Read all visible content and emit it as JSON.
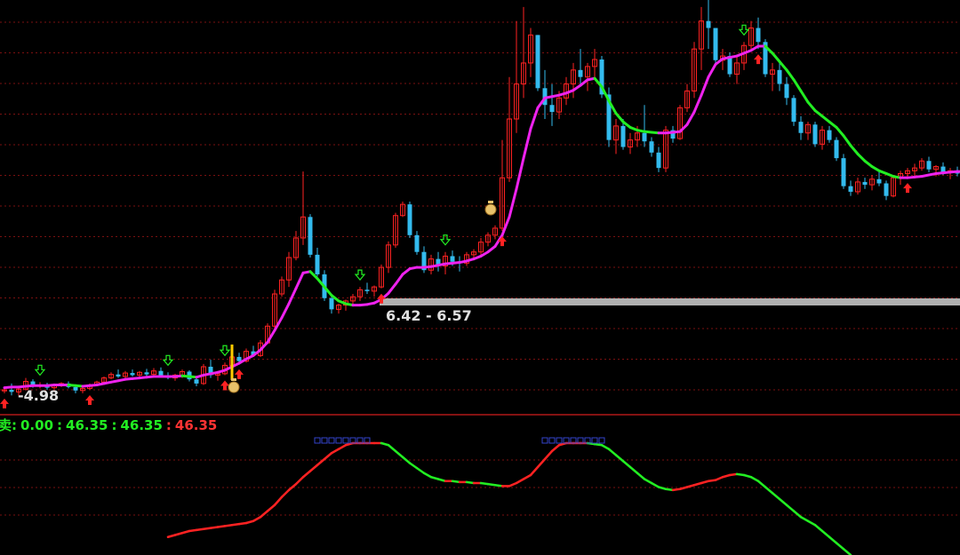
{
  "colors": {
    "background": "#000000",
    "grid": "#7a1010",
    "separator": "#b01818",
    "candle_up": "#ff2222",
    "candle_down": "#33bbee",
    "ma_rising": "#ee22ee",
    "ma_falling": "#22ee22",
    "osc_rising": "#ff2222",
    "osc_falling": "#22ee22",
    "zone_band": "#b0b0b0",
    "zone_text": "#e0e0e0",
    "buy_arrow": "#ff2222",
    "sell_arrow": "#22ee22",
    "signal_bar": "#ffcc00",
    "label_green": "#22ee22",
    "label_red": "#ff3333",
    "top_marker": "#3344cc"
  },
  "price_panel": {
    "zone_label": "6.42 - 6.57",
    "low_label": "4.98",
    "money_bag_icon": "money-bag-icon"
  },
  "indicator_panel": {
    "title_prefix": "卖:",
    "value_1": "0.00",
    "sep_1": ":",
    "value_2": "46.35",
    "sep_2": ":",
    "value_3": "46.35",
    "sep_3": ":",
    "value_4": "46.35"
  },
  "chart_data": [
    {
      "type": "candlestick",
      "candles": [
        [
          4.92,
          4.95,
          4.88,
          4.93
        ],
        [
          4.93,
          5.02,
          4.85,
          4.9
        ],
        [
          4.9,
          4.96,
          4.85,
          4.94
        ],
        [
          4.94,
          5.1,
          4.92,
          5.05
        ],
        [
          5.05,
          5.08,
          4.96,
          4.98
        ],
        [
          4.98,
          5.04,
          4.95,
          5.0
        ],
        [
          5.0,
          5.03,
          4.93,
          4.96
        ],
        [
          4.96,
          5.02,
          4.94,
          5.0
        ],
        [
          5.0,
          5.04,
          4.97,
          5.02
        ],
        [
          5.02,
          5.05,
          4.95,
          4.97
        ],
        [
          4.97,
          5.0,
          4.88,
          4.92
        ],
        [
          4.92,
          4.97,
          4.88,
          4.95
        ],
        [
          4.95,
          5.02,
          4.93,
          5.0
        ],
        [
          5.0,
          5.06,
          4.98,
          5.04
        ],
        [
          5.04,
          5.12,
          5.02,
          5.1
        ],
        [
          5.1,
          5.18,
          5.08,
          5.15
        ],
        [
          5.15,
          5.22,
          5.1,
          5.12
        ],
        [
          5.12,
          5.2,
          5.09,
          5.17
        ],
        [
          5.17,
          5.22,
          5.12,
          5.14
        ],
        [
          5.14,
          5.2,
          5.1,
          5.18
        ],
        [
          5.18,
          5.23,
          5.12,
          5.15
        ],
        [
          5.15,
          5.24,
          5.11,
          5.2
        ],
        [
          5.2,
          5.25,
          5.12,
          5.13
        ],
        [
          5.13,
          5.18,
          5.08,
          5.1
        ],
        [
          5.1,
          5.16,
          5.06,
          5.14
        ],
        [
          5.14,
          5.22,
          5.1,
          5.19
        ],
        [
          5.19,
          5.21,
          5.05,
          5.08
        ],
        [
          5.08,
          5.1,
          4.98,
          5.02
        ],
        [
          5.02,
          5.3,
          5.0,
          5.26
        ],
        [
          5.26,
          5.36,
          5.1,
          5.14
        ],
        [
          5.14,
          5.2,
          5.06,
          5.16
        ],
        [
          5.16,
          5.32,
          5.14,
          5.28
        ],
        [
          5.28,
          5.45,
          5.25,
          5.4
        ],
        [
          5.4,
          5.46,
          5.3,
          5.34
        ],
        [
          5.34,
          5.52,
          5.32,
          5.48
        ],
        [
          5.48,
          5.56,
          5.4,
          5.42
        ],
        [
          5.42,
          5.64,
          5.4,
          5.6
        ],
        [
          5.6,
          5.88,
          5.58,
          5.84
        ],
        [
          5.84,
          6.36,
          5.8,
          6.3
        ],
        [
          6.3,
          6.55,
          6.26,
          6.5
        ],
        [
          6.5,
          6.9,
          6.4,
          6.82
        ],
        [
          6.82,
          7.2,
          6.78,
          7.1
        ],
        [
          7.1,
          8.05,
          7.0,
          7.4
        ],
        [
          7.4,
          7.44,
          6.82,
          6.86
        ],
        [
          6.86,
          6.96,
          6.55,
          6.58
        ],
        [
          6.58,
          6.64,
          6.2,
          6.24
        ],
        [
          6.24,
          6.3,
          6.02,
          6.08
        ],
        [
          6.08,
          6.16,
          6.02,
          6.14
        ],
        [
          6.14,
          6.22,
          6.06,
          6.2
        ],
        [
          6.2,
          6.3,
          6.12,
          6.26
        ],
        [
          6.26,
          6.4,
          6.2,
          6.36
        ],
        [
          6.36,
          6.46,
          6.3,
          6.34
        ],
        [
          6.34,
          6.42,
          6.26,
          6.4
        ],
        [
          6.4,
          6.72,
          6.38,
          6.68
        ],
        [
          6.68,
          7.05,
          6.6,
          7.0
        ],
        [
          7.0,
          7.46,
          6.96,
          7.42
        ],
        [
          7.42,
          7.62,
          7.4,
          7.58
        ],
        [
          7.58,
          7.62,
          7.1,
          7.14
        ],
        [
          7.14,
          7.2,
          6.86,
          6.9
        ],
        [
          6.9,
          6.98,
          6.6,
          6.64
        ],
        [
          6.64,
          6.86,
          6.58,
          6.8
        ],
        [
          6.8,
          6.9,
          6.62,
          6.7
        ],
        [
          6.7,
          6.9,
          6.58,
          6.84
        ],
        [
          6.84,
          6.92,
          6.7,
          6.76
        ],
        [
          6.76,
          6.84,
          6.62,
          6.74
        ],
        [
          6.74,
          6.9,
          6.7,
          6.86
        ],
        [
          6.86,
          6.94,
          6.78,
          6.9
        ],
        [
          6.9,
          7.1,
          6.85,
          7.04
        ],
        [
          7.04,
          7.18,
          6.98,
          7.14
        ],
        [
          7.14,
          7.28,
          7.08,
          7.24
        ],
        [
          7.24,
          8.5,
          7.2,
          7.96
        ],
        [
          7.96,
          9.4,
          7.9,
          8.8
        ],
        [
          8.8,
          10.2,
          8.6,
          9.3
        ],
        [
          9.3,
          10.4,
          9.1,
          9.6
        ],
        [
          9.6,
          10.1,
          9.4,
          10.0
        ],
        [
          10.0,
          10.0,
          9.2,
          9.24
        ],
        [
          9.24,
          9.5,
          8.8,
          9.0
        ],
        [
          9.0,
          9.3,
          8.7,
          8.9
        ],
        [
          8.9,
          9.2,
          8.8,
          9.1
        ],
        [
          9.1,
          9.4,
          9.0,
          9.3
        ],
        [
          9.3,
          9.6,
          9.1,
          9.5
        ],
        [
          9.5,
          9.8,
          9.3,
          9.4
        ],
        [
          9.4,
          9.6,
          9.2,
          9.55
        ],
        [
          9.55,
          9.8,
          9.4,
          9.65
        ],
        [
          9.65,
          9.7,
          9.1,
          9.15
        ],
        [
          9.15,
          9.25,
          8.4,
          8.5
        ],
        [
          8.5,
          8.8,
          8.3,
          8.7
        ],
        [
          8.7,
          8.8,
          8.36,
          8.4
        ],
        [
          8.4,
          8.6,
          8.3,
          8.5
        ],
        [
          8.5,
          8.7,
          8.4,
          8.6
        ],
        [
          8.6,
          9.0,
          8.4,
          8.48
        ],
        [
          8.48,
          8.54,
          8.26,
          8.32
        ],
        [
          8.32,
          8.4,
          8.04,
          8.1
        ],
        [
          8.1,
          8.7,
          8.04,
          8.64
        ],
        [
          8.64,
          8.7,
          8.46,
          8.52
        ],
        [
          8.52,
          9.0,
          8.5,
          8.96
        ],
        [
          8.96,
          9.3,
          8.9,
          9.2
        ],
        [
          9.2,
          9.9,
          9.1,
          9.8
        ],
        [
          9.8,
          10.4,
          9.5,
          10.2
        ],
        [
          10.2,
          10.6,
          9.8,
          10.1
        ],
        [
          10.1,
          10.1,
          9.6,
          9.64
        ],
        [
          9.64,
          9.8,
          9.5,
          9.7
        ],
        [
          9.7,
          9.75,
          9.4,
          9.44
        ],
        [
          9.44,
          9.7,
          9.3,
          9.6
        ],
        [
          9.6,
          9.9,
          9.5,
          9.85
        ],
        [
          9.85,
          10.2,
          9.8,
          10.1
        ],
        [
          10.1,
          10.25,
          9.8,
          9.9
        ],
        [
          9.9,
          9.94,
          9.4,
          9.44
        ],
        [
          9.44,
          9.6,
          9.2,
          9.5
        ],
        [
          9.5,
          9.6,
          9.2,
          9.3
        ],
        [
          9.3,
          9.4,
          9.0,
          9.1
        ],
        [
          9.1,
          9.14,
          8.7,
          8.76
        ],
        [
          8.76,
          8.84,
          8.5,
          8.6
        ],
        [
          8.6,
          8.76,
          8.5,
          8.72
        ],
        [
          8.72,
          8.76,
          8.4,
          8.44
        ],
        [
          8.44,
          8.7,
          8.36,
          8.64
        ],
        [
          8.64,
          8.7,
          8.46,
          8.5
        ],
        [
          8.5,
          8.54,
          8.2,
          8.24
        ],
        [
          8.24,
          8.3,
          7.8,
          7.84
        ],
        [
          7.84,
          7.92,
          7.7,
          7.76
        ],
        [
          7.76,
          7.96,
          7.72,
          7.9
        ],
        [
          7.9,
          7.96,
          7.8,
          7.86
        ],
        [
          7.86,
          8.0,
          7.78,
          7.94
        ],
        [
          7.94,
          8.04,
          7.84,
          7.88
        ],
        [
          7.88,
          7.92,
          7.64,
          7.7
        ],
        [
          7.7,
          8.0,
          7.68,
          7.96
        ],
        [
          7.96,
          8.06,
          7.86,
          8.02
        ],
        [
          8.02,
          8.1,
          7.96,
          8.06
        ],
        [
          8.06,
          8.16,
          7.98,
          8.1
        ],
        [
          8.1,
          8.24,
          8.06,
          8.2
        ],
        [
          8.2,
          8.26,
          8.04,
          8.08
        ],
        [
          8.08,
          8.14,
          7.98,
          8.12
        ],
        [
          8.12,
          8.18,
          8.0,
          8.04
        ],
        [
          8.04,
          8.1,
          7.94,
          8.06
        ],
        [
          8.06,
          8.12,
          7.98,
          8.02
        ],
        [
          8.02,
          8.16,
          7.96,
          8.12
        ],
        [
          8.12,
          8.22,
          8.06,
          8.18
        ],
        [
          8.18,
          8.3,
          8.12,
          8.26
        ]
      ],
      "ma": [
        4.96,
        4.97,
        4.97,
        4.98,
        4.99,
        4.99,
        4.99,
        5.0,
        5.0,
        5.0,
        4.99,
        4.98,
        4.99,
        5.0,
        5.02,
        5.04,
        5.06,
        5.08,
        5.09,
        5.1,
        5.11,
        5.12,
        5.12,
        5.12,
        5.12,
        5.13,
        5.12,
        5.11,
        5.14,
        5.16,
        5.18,
        5.21,
        5.26,
        5.31,
        5.37,
        5.42,
        5.5,
        5.61,
        5.78,
        5.96,
        6.16,
        6.38,
        6.6,
        6.62,
        6.52,
        6.4,
        6.28,
        6.2,
        6.16,
        6.14,
        6.14,
        6.15,
        6.17,
        6.22,
        6.31,
        6.44,
        6.58,
        6.66,
        6.68,
        6.68,
        6.69,
        6.71,
        6.73,
        6.74,
        6.75,
        6.77,
        6.8,
        6.84,
        6.9,
        6.98,
        7.14,
        7.4,
        7.8,
        8.24,
        8.66,
        8.96,
        9.1,
        9.12,
        9.14,
        9.17,
        9.21,
        9.28,
        9.36,
        9.38,
        9.26,
        9.06,
        8.88,
        8.76,
        8.68,
        8.64,
        8.62,
        8.61,
        8.6,
        8.6,
        8.61,
        8.62,
        8.72,
        8.9,
        9.14,
        9.4,
        9.58,
        9.66,
        9.68,
        9.7,
        9.74,
        9.78,
        9.84,
        9.84,
        9.74,
        9.62,
        9.5,
        9.36,
        9.2,
        9.04,
        8.92,
        8.84,
        8.76,
        8.68,
        8.56,
        8.42,
        8.3,
        8.2,
        8.12,
        8.06,
        8.02,
        7.98,
        7.96,
        7.96,
        7.97,
        7.98,
        8.0,
        8.02,
        8.03,
        8.04,
        8.05,
        8.05,
        8.05,
        8.06,
        8.08,
        8.1
      ],
      "buy_signals": [
        0,
        12,
        31,
        33,
        53,
        70,
        106,
        127
      ],
      "sell_signals": [
        5,
        23,
        31,
        50,
        62,
        104
      ],
      "price_zone": [
        6.42,
        6.57
      ],
      "low_label": 4.98
    },
    {
      "type": "line",
      "x_first": 0,
      "values": [
        null,
        null,
        null,
        null,
        null,
        null,
        null,
        null,
        null,
        null,
        null,
        null,
        null,
        null,
        null,
        null,
        null,
        null,
        null,
        null,
        null,
        null,
        null,
        8,
        10,
        12,
        14,
        15,
        16,
        17,
        18,
        19,
        20,
        21,
        22,
        24,
        28,
        34,
        40,
        48,
        55,
        61,
        68,
        74,
        80,
        86,
        92,
        96,
        100,
        102,
        102,
        102,
        102,
        102,
        100,
        94,
        88,
        82,
        77,
        72,
        68,
        66,
        64,
        64,
        63,
        63,
        62,
        62,
        61,
        60,
        59,
        59,
        62,
        66,
        70,
        78,
        86,
        94,
        100,
        102,
        102,
        102,
        102,
        101,
        100,
        96,
        90,
        84,
        78,
        72,
        66,
        62,
        58,
        56,
        55,
        56,
        58,
        60,
        62,
        64,
        65,
        68,
        70,
        71,
        70,
        68,
        64,
        58,
        52,
        46,
        40,
        34,
        28,
        24,
        20,
        14,
        8,
        2,
        -4,
        -10
      ],
      "top_marks": [
        [
          44,
          52
        ],
        [
          76,
          85
        ]
      ]
    }
  ]
}
